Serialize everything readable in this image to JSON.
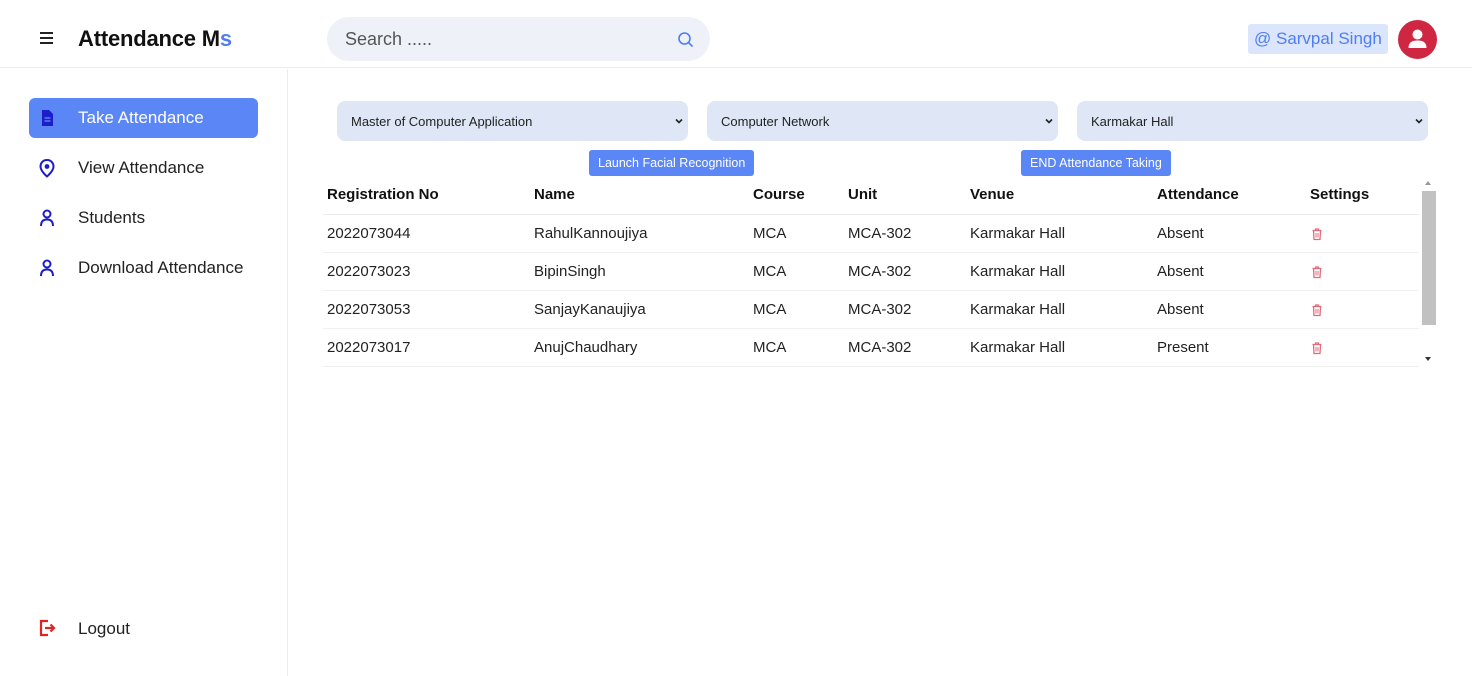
{
  "header": {
    "brand_main": "Attendance M",
    "brand_accent": "s",
    "search_placeholder": "Search .....",
    "user_label": "@ Sarvpal Singh"
  },
  "sidebar": {
    "items": [
      {
        "label": "Take Attendance",
        "icon": "document-icon",
        "active": true
      },
      {
        "label": "View Attendance",
        "icon": "location-pin-icon",
        "active": false
      },
      {
        "label": "Students",
        "icon": "user-icon",
        "active": false
      },
      {
        "label": "Download Attendance",
        "icon": "user-icon",
        "active": false
      }
    ],
    "logout_label": "Logout"
  },
  "filters": {
    "course": "Master of Computer Application",
    "unit": "Computer Network",
    "venue": "Karmakar Hall"
  },
  "actions": {
    "launch_label": "Launch Facial Recognition",
    "end_label": "END Attendance Taking"
  },
  "table": {
    "headers": [
      "Registration No",
      "Name",
      "Course",
      "Unit",
      "Venue",
      "Attendance",
      "Settings"
    ],
    "rows": [
      [
        "2022073044",
        "RahulKannoujiya",
        "MCA",
        "MCA-302",
        "Karmakar Hall",
        "Absent"
      ],
      [
        "2022073023",
        "BipinSingh",
        "MCA",
        "MCA-302",
        "Karmakar Hall",
        "Absent"
      ],
      [
        "2022073053",
        "SanjayKanaujiya",
        "MCA",
        "MCA-302",
        "Karmakar Hall",
        "Absent"
      ],
      [
        "2022073017",
        "AnujChaudhary",
        "MCA",
        "MCA-302",
        "Karmakar Hall",
        "Present"
      ]
    ]
  },
  "colors": {
    "accent": "#5b86f5",
    "avatar": "#cf2741",
    "delete_icon": "#e06b7d",
    "logout_icon": "#e02424",
    "nav_icon": "#1e1ec8"
  }
}
